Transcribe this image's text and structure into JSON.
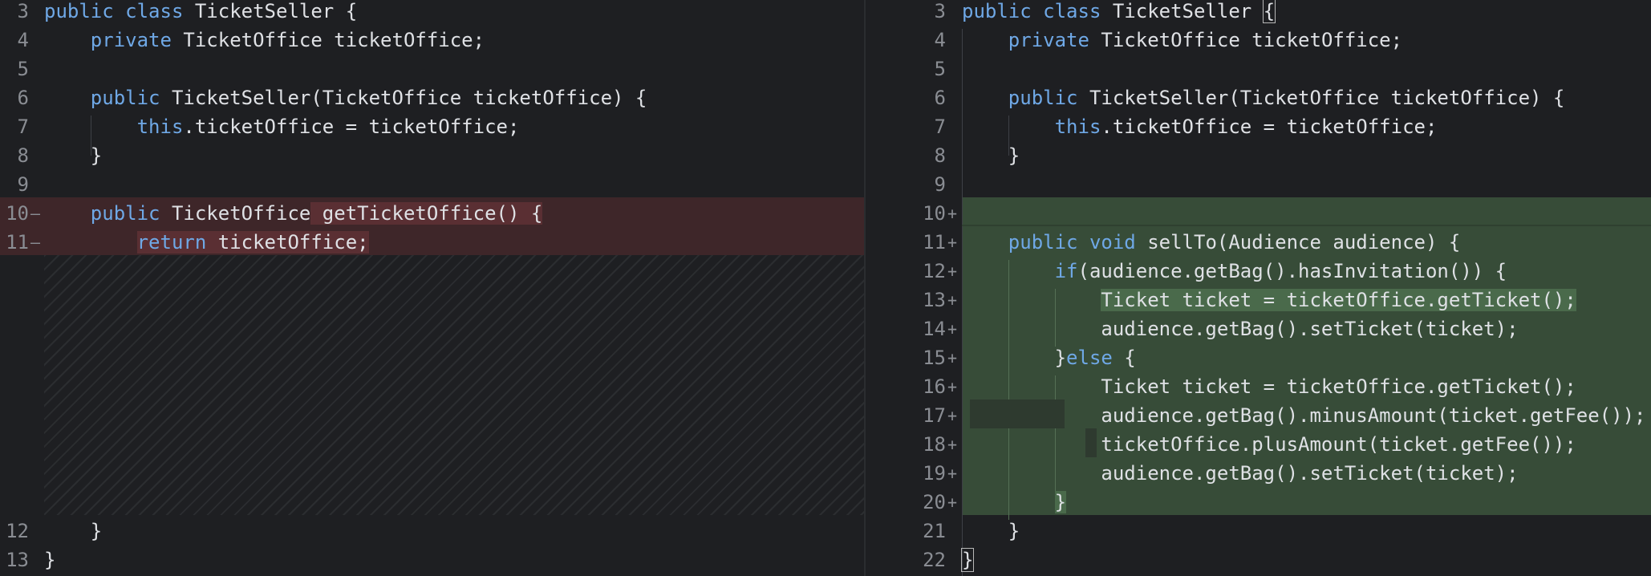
{
  "left": {
    "gutter": [
      {
        "n": "3",
        "mark": ""
      },
      {
        "n": "4",
        "mark": ""
      },
      {
        "n": "5",
        "mark": ""
      },
      {
        "n": "6",
        "mark": ""
      },
      {
        "n": "7",
        "mark": ""
      },
      {
        "n": "8",
        "mark": ""
      },
      {
        "n": "9",
        "mark": ""
      },
      {
        "n": "10",
        "mark": "—"
      },
      {
        "n": "11",
        "mark": "—"
      },
      {
        "n": "12",
        "mark": ""
      },
      {
        "n": "13",
        "mark": ""
      }
    ],
    "code": {
      "l3_kw1": "public",
      "l3_kw2": "class",
      "l3_txt": " TicketSeller {",
      "l4_kw": "private",
      "l4_txt": " TicketOffice ticketOffice;",
      "l6_kw": "public",
      "l6_txt": " TicketSeller(TicketOffice ticketOffice) {",
      "l7_kw": "this",
      "l7_txt": ".ticketOffice = ticketOffice;",
      "l8_txt": "}",
      "l10_kw": "public",
      "l10_a": " TicketOffice",
      "l10_b": " getTicketOffice() {",
      "l11_kw": "return",
      "l11_txt": " ticketOffice;",
      "l12_txt": "}",
      "l13_txt": "}"
    }
  },
  "right": {
    "gutter": [
      {
        "n": "3",
        "mark": ""
      },
      {
        "n": "4",
        "mark": ""
      },
      {
        "n": "5",
        "mark": ""
      },
      {
        "n": "6",
        "mark": ""
      },
      {
        "n": "7",
        "mark": ""
      },
      {
        "n": "8",
        "mark": ""
      },
      {
        "n": "9",
        "mark": ""
      },
      {
        "n": "10",
        "mark": "+"
      },
      {
        "n": "11",
        "mark": "+"
      },
      {
        "n": "12",
        "mark": "+"
      },
      {
        "n": "13",
        "mark": "+"
      },
      {
        "n": "14",
        "mark": "+"
      },
      {
        "n": "15",
        "mark": "+"
      },
      {
        "n": "16",
        "mark": "+"
      },
      {
        "n": "17",
        "mark": "+"
      },
      {
        "n": "18",
        "mark": "+"
      },
      {
        "n": "19",
        "mark": "+"
      },
      {
        "n": "20",
        "mark": "+"
      },
      {
        "n": "21",
        "mark": ""
      },
      {
        "n": "22",
        "mark": ""
      }
    ],
    "code": {
      "l3_kw1": "public",
      "l3_kw2": "class",
      "l3_txt": " TicketSeller ",
      "l3_brace": "{",
      "l4_kw": "private",
      "l4_txt": " TicketOffice ticketOffice;",
      "l6_kw": "public",
      "l6_txt": " TicketSeller(TicketOffice ticketOffice) {",
      "l7_kw": "this",
      "l7_txt": ".ticketOffice = ticketOffice;",
      "l8_txt": "}",
      "l11_kw1": "public",
      "l11_kw2": "void",
      "l11_txt": " sellTo(Audience audience) {",
      "l12_kw": "if",
      "l12_txt": "(audience.getBag().hasInvitation()) {",
      "l13_txt": "Ticket ticket = ticketOffice.getTicket();",
      "l14_txt": "audience.getBag().setTicket(ticket);",
      "l15_a": "}",
      "l15_kw": "else",
      "l15_b": " {",
      "l16_txt": "Ticket ticket = ticketOffice.getTicket();",
      "l17_txt": "audience.getBag().minusAmount(ticket.getFee());",
      "l18_txt": "ticketOffice.plusAmount(ticket.getFee());",
      "l19_txt": "audience.getBag().setTicket(ticket);",
      "l20_txt": "}",
      "l21_txt": "}",
      "l22_txt": "}"
    }
  },
  "colors": {
    "deleted": "#3e2629",
    "added": "#374c38",
    "keyword": "#6fa8e6",
    "background": "#1e1f22"
  }
}
